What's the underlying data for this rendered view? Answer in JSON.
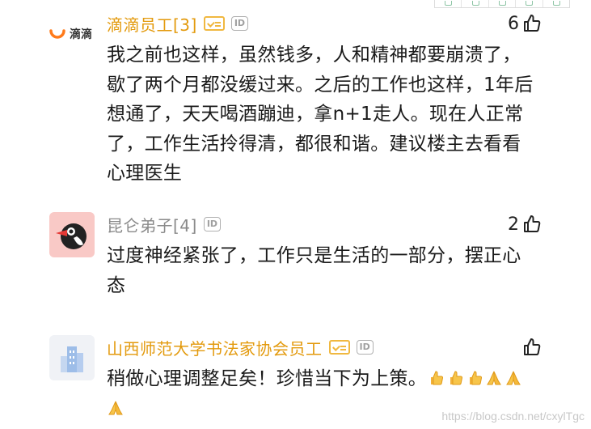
{
  "comments": [
    {
      "username": "滴滴员工[3]",
      "avatar_text": "滴滴",
      "has_v_badge": true,
      "has_id_badge": true,
      "id_label": "ID",
      "likes": "6",
      "text": "我之前也这样，虽然钱多，人和精神都要崩溃了，歇了两个月都没缓过来。之后的工作也这样，1年后想通了，天天喝酒蹦迪，拿n+1走人。现在人正常了，工作生活拎得清，都很和谐。建议楼主去看看心理医生"
    },
    {
      "username": "昆仑弟子[4]",
      "has_v_badge": false,
      "has_id_badge": true,
      "id_label": "ID",
      "likes": "2",
      "text": "过度神经紧张了，工作只是生活的一部分，摆正心态"
    },
    {
      "username": "山西师范大学书法家协会员工",
      "has_v_badge": true,
      "has_id_badge": true,
      "id_label": "ID",
      "likes": "",
      "text": "稍做心理调整足矣！珍惜当下为上策。"
    }
  ],
  "emojis": [
    "thumbs-up",
    "thumbs-up",
    "thumbs-up",
    "folded-hands",
    "folded-hands",
    "folded-hands"
  ],
  "watermark": "https://blog.csdn.net/cxylTgc",
  "colors": {
    "orange_name": "#e39a0d",
    "gray_name": "#8a8a8a",
    "badge_gold": "#f0b840",
    "didi_orange": "#ff7a1a"
  }
}
